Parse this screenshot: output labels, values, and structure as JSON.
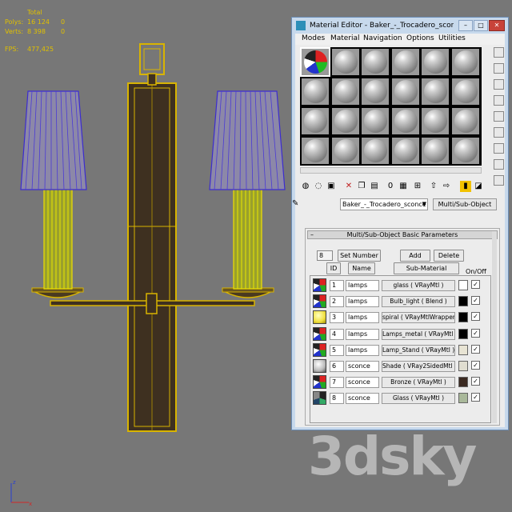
{
  "viewport": {
    "stats": {
      "header": "Total",
      "polys_label": "Polys:",
      "polys_total": "16 124",
      "polys_sel": "0",
      "verts_label": "Verts:",
      "verts_total": "8 398",
      "verts_sel": "0",
      "fps_label": "FPS:",
      "fps_value": "477,425"
    },
    "watermark": "3dsky",
    "axis": {
      "x": "x",
      "y": "y",
      "z": "z"
    }
  },
  "material_editor": {
    "title": "Material Editor - Baker_-_Trocadero_sconc...",
    "window_buttons": [
      "–",
      "□",
      "✕"
    ],
    "menu": [
      "Modes",
      "Material",
      "Navigation",
      "Options",
      "Utilities"
    ],
    "material_name": "Baker_-_Trocadero_sconce",
    "material_type": "Multi/Sub-Object",
    "rollout_title": "Multi/Sub-Object Basic Parameters",
    "rollout_toggle": "–",
    "count": "8",
    "set_number_label": "Set Number",
    "add_label": "Add",
    "delete_label": "Delete",
    "columns": {
      "id": "ID",
      "name": "Name",
      "sub_material": "Sub-Material",
      "on_off": "On/Off"
    },
    "rows": [
      {
        "id": "1",
        "name": "lamps",
        "material": "glass  ( VRayMtl )",
        "color": "#ffffff",
        "on": "✓",
        "thumb": "multicolor"
      },
      {
        "id": "2",
        "name": "lamps",
        "material": "Bulb_light  ( Blend )",
        "color": "#000000",
        "on": "✓",
        "thumb": "multicolor"
      },
      {
        "id": "3",
        "name": "lamps",
        "material": "spiral  ( VRayMtlWrapper )",
        "color": "#000000",
        "on": "✓",
        "thumb": "yellow-sphere"
      },
      {
        "id": "4",
        "name": "lamps",
        "material": "Lamps_metal  ( VRayMtl )",
        "color": "#000000",
        "on": "✓",
        "thumb": "multicolor"
      },
      {
        "id": "5",
        "name": "lamps",
        "material": "Lamp_Stand  ( VRayMtl )",
        "color": "#e8e4d4",
        "on": "✓",
        "thumb": "multicolor"
      },
      {
        "id": "6",
        "name": "sconce",
        "material": "Shade  ( VRay2SidedMtl )",
        "color": "#e0ddd0",
        "on": "✓",
        "thumb": "grey-sphere"
      },
      {
        "id": "7",
        "name": "sconce",
        "material": "Bronze  ( VRayMtl )",
        "color": "#3b2a22",
        "on": "✓",
        "thumb": "multicolor"
      },
      {
        "id": "8",
        "name": "sconce",
        "material": "Glass  ( VRayMtl )",
        "color": "#a9b89a",
        "on": "✓",
        "thumb": "dark-multicolor"
      }
    ]
  }
}
